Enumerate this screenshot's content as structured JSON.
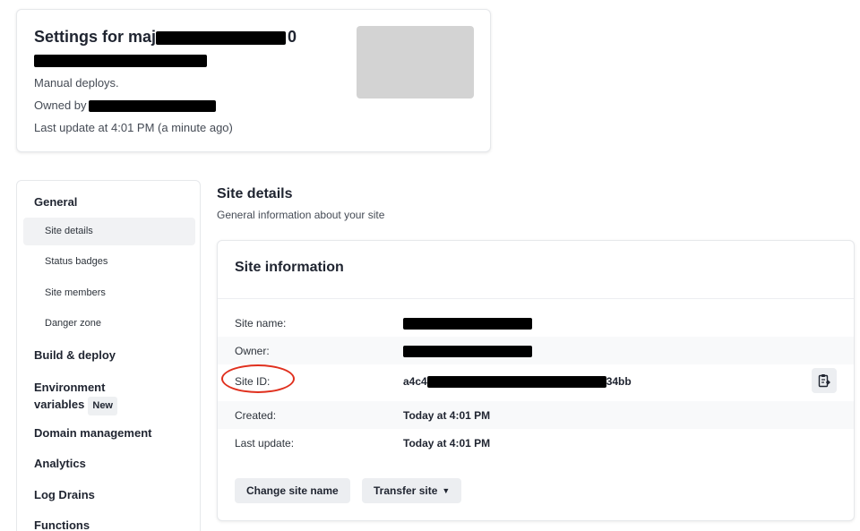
{
  "header": {
    "title_prefix": "Settings for maj",
    "title_suffix": "0",
    "deploy_mode": "Manual deploys.",
    "owned_by_label": "Owned by",
    "last_update": "Last update at 4:01 PM (a minute ago)"
  },
  "sidebar": {
    "general": "General",
    "general_items": [
      "Site details",
      "Status badges",
      "Site members",
      "Danger zone"
    ],
    "active_item": "Site details",
    "build_deploy": "Build & deploy",
    "env_vars_line1": "Environment",
    "env_vars_line2": "variables",
    "env_vars_badge": "New",
    "domain_management": "Domain management",
    "analytics": "Analytics",
    "log_drains": "Log Drains",
    "functions": "Functions"
  },
  "section": {
    "title": "Site details",
    "description": "General information about your site"
  },
  "site_information": {
    "title": "Site information",
    "rows": {
      "name": {
        "label": "Site name:"
      },
      "owner": {
        "label": "Owner:"
      },
      "site_id": {
        "label": "Site ID:",
        "value_prefix": "a4c4",
        "value_suffix": "34bb"
      },
      "created": {
        "label": "Created:",
        "value": "Today at 4:01 PM"
      },
      "last_update": {
        "label": "Last update:",
        "value": "Today at 4:01 PM"
      }
    },
    "buttons": {
      "change_name": "Change site name",
      "transfer": "Transfer site"
    }
  },
  "icons": {
    "copy": "clipboard-copy-icon",
    "transfer_chevron": "chevron-down-icon"
  },
  "colors": {
    "highlight_circle": "#e0301e",
    "button_bg": "#eceef1",
    "active_nav_bg": "#f1f2f4"
  }
}
